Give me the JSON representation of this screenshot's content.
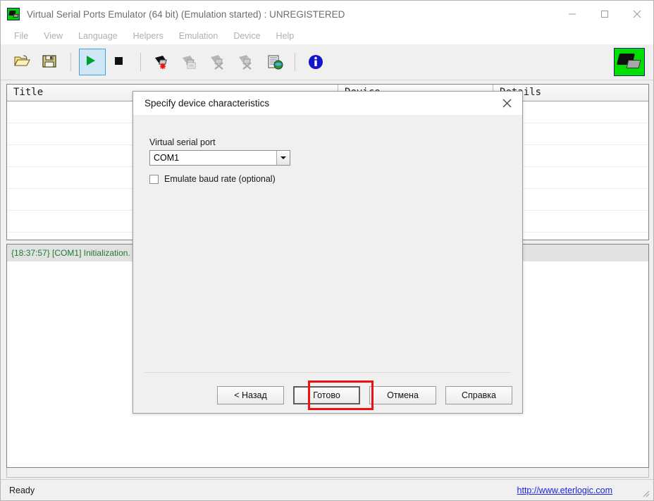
{
  "window": {
    "title": "Virtual Serial Ports Emulator (64 bit) (Emulation started) : UNREGISTERED",
    "app_icon": "serial-port-icon",
    "controls": {
      "minimize": "minimize-icon",
      "maximize": "maximize-icon",
      "close": "close-icon"
    }
  },
  "menu": {
    "items": [
      {
        "label": "File"
      },
      {
        "label": "View"
      },
      {
        "label": "Language"
      },
      {
        "label": "Helpers"
      },
      {
        "label": "Emulation"
      },
      {
        "label": "Device"
      },
      {
        "label": "Help"
      }
    ]
  },
  "toolbar": {
    "buttons": [
      {
        "name": "open-icon",
        "title": "Open"
      },
      {
        "name": "save-icon",
        "title": "Save"
      },
      {
        "name": "start-emulation-icon",
        "title": "Start emulation"
      },
      {
        "name": "stop-emulation-icon",
        "title": "Stop emulation"
      },
      {
        "name": "add-device-icon",
        "title": "Add device"
      },
      {
        "name": "edit-device-icon",
        "title": "Edit device"
      },
      {
        "name": "delete-device-icon",
        "title": "Delete device"
      },
      {
        "name": "delete-all-devices-icon",
        "title": "Delete all devices"
      },
      {
        "name": "report-icon",
        "title": "Report"
      },
      {
        "name": "info-icon",
        "title": "About"
      }
    ],
    "right_icon": "serial-port-icon"
  },
  "device_list": {
    "columns": [
      "Title",
      "Device",
      "Details"
    ],
    "rows": []
  },
  "log": {
    "entries": [
      {
        "text": "{18:37:57} [COM1] Initialization.",
        "color": "#1f7a32"
      }
    ]
  },
  "status_bar": {
    "text": "Ready",
    "link": "http://www.eterlogic.com"
  },
  "dialog": {
    "title": "Specify device characteristics",
    "close_icon": "close-icon",
    "field_label": "Virtual serial port",
    "port_value": "COM1",
    "port_options": [
      "COM1"
    ],
    "checkbox_label": "Emulate baud rate (optional)",
    "checkbox_checked": false,
    "buttons": [
      {
        "label": "< Назад",
        "default": false
      },
      {
        "label": "Готово",
        "default": true
      },
      {
        "label": "Отмена",
        "default": false
      },
      {
        "label": "Справка",
        "default": false
      }
    ],
    "highlight_color": "#ee1111"
  }
}
